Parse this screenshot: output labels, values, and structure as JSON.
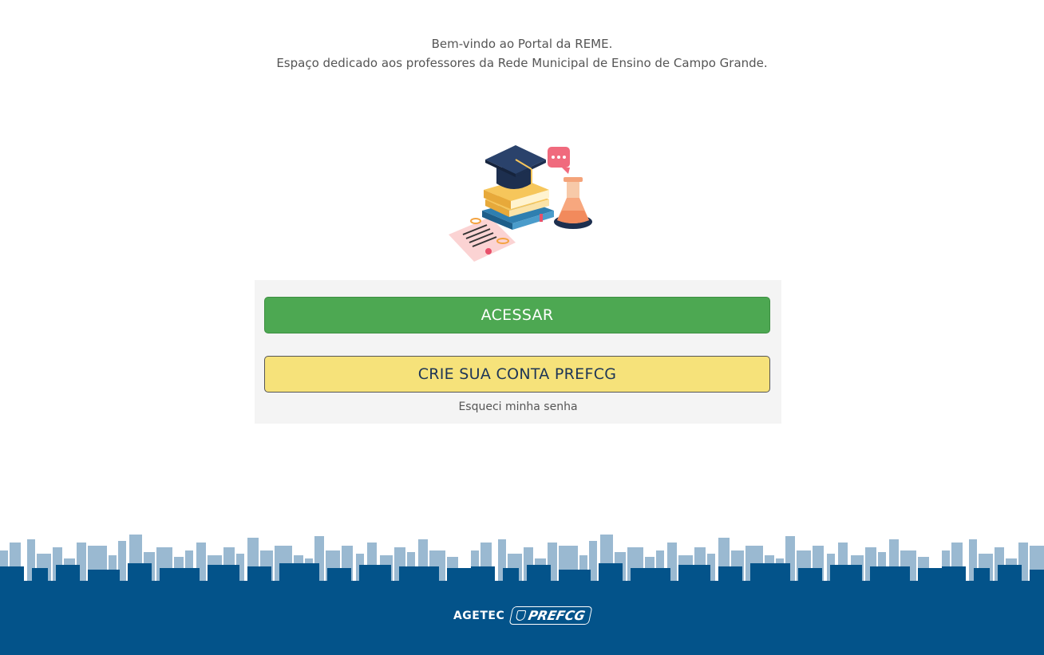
{
  "header": {
    "welcome_line1": "Bem-vindo ao Portal da REME.",
    "welcome_line2": "Espaço dedicado aos professores da Rede Municipal de Ensino de Campo Grande."
  },
  "login_card": {
    "access_label": "ACESSAR",
    "create_account_label": "CRIE SUA CONTA PREFCG",
    "forgot_password_label": "Esqueci minha senha"
  },
  "footer": {
    "agetec_logo": "AGETEC",
    "prefcg_logo": "PREFCG"
  },
  "colors": {
    "access_button": "#4da852",
    "create_button": "#f6e27a",
    "footer_band": "#03538a",
    "skyline": "#9ab9d1"
  }
}
